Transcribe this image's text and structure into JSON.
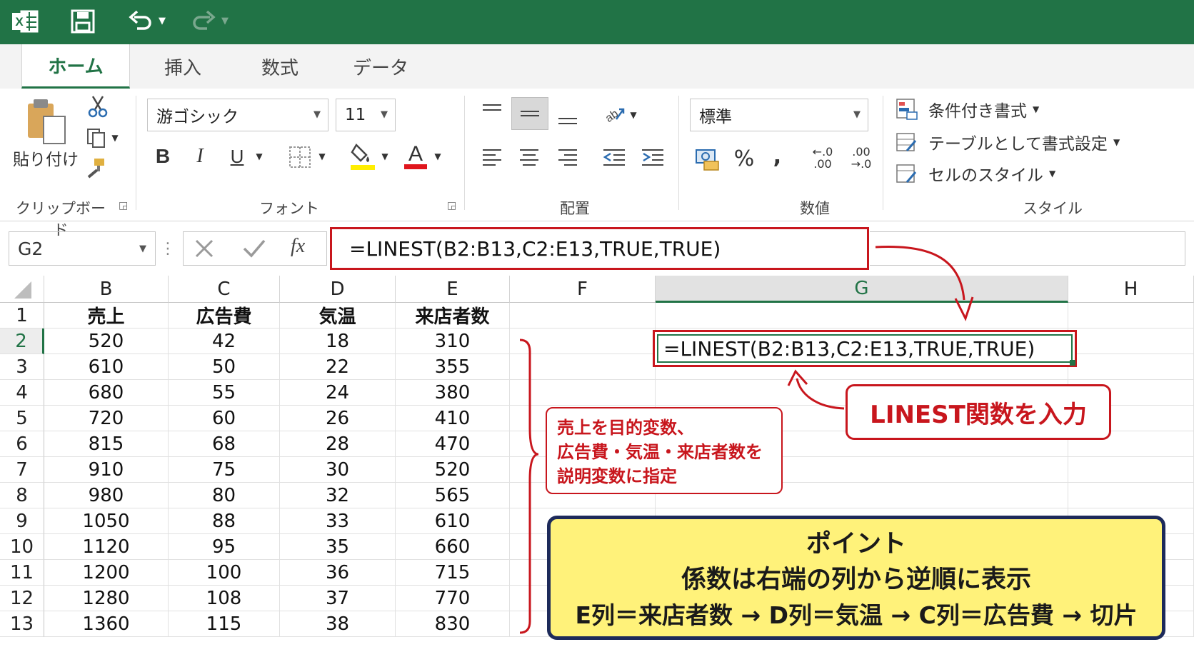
{
  "titlebar": {
    "excel_icon": "excel-logo-icon",
    "save_icon": "save-icon",
    "undo_icon": "undo-icon",
    "redo_icon": "redo-icon"
  },
  "tabs": [
    {
      "label": "ホーム",
      "active": true
    },
    {
      "label": "挿入"
    },
    {
      "label": "数式"
    },
    {
      "label": "データ"
    }
  ],
  "ribbon": {
    "clipboard": {
      "paste_label": "貼り付け",
      "group_label": "クリップボード"
    },
    "font": {
      "font_name": "游ゴシック",
      "font_size": "11",
      "bold": "B",
      "italic": "I",
      "underline": "U",
      "font_color_letter": "A",
      "group_label": "フォント",
      "highlight_color": "#ffee00",
      "font_color": "#e0161d"
    },
    "alignment": {
      "group_label": "配置"
    },
    "number": {
      "format": "標準",
      "percent": "%",
      "comma": "‚",
      "inc_decimal": "←.0\n.00",
      "dec_decimal": ".00\n→.0",
      "group_label": "数値"
    },
    "styles": {
      "conditional": "条件付き書式",
      "table": "テーブルとして書式設定",
      "cell": "セルのスタイル",
      "group_label": "スタイル"
    }
  },
  "formula_bar": {
    "name_box": "G2",
    "fx": "fx",
    "formula": "=LINEST(B2:B13,C2:E13,TRUE,TRUE)"
  },
  "sheet": {
    "columns": [
      "B",
      "C",
      "D",
      "E",
      "F",
      "G",
      "H"
    ],
    "selected_column": "G",
    "rows": [
      "1",
      "2",
      "3",
      "4",
      "5",
      "6",
      "7",
      "8",
      "9",
      "10",
      "11",
      "12",
      "13"
    ],
    "selected_row": "2",
    "header_cells": [
      "売上",
      "広告費",
      "気温",
      "来店者数"
    ],
    "data": [
      [
        "520",
        "42",
        "18",
        "310"
      ],
      [
        "610",
        "50",
        "22",
        "355"
      ],
      [
        "680",
        "55",
        "24",
        "380"
      ],
      [
        "720",
        "60",
        "26",
        "410"
      ],
      [
        "815",
        "68",
        "28",
        "470"
      ],
      [
        "910",
        "75",
        "30",
        "520"
      ],
      [
        "980",
        "80",
        "32",
        "565"
      ],
      [
        "1050",
        "88",
        "33",
        "610"
      ],
      [
        "1120",
        "95",
        "35",
        "660"
      ],
      [
        "1200",
        "100",
        "36",
        "715"
      ],
      [
        "1280",
        "108",
        "37",
        "770"
      ],
      [
        "1360",
        "115",
        "38",
        "830"
      ]
    ],
    "active_cell_value": "=LINEST(B2:B13,C2:E13,TRUE,TRUE)"
  },
  "annotations": {
    "callout_input": "LINEST関数を入力",
    "callout_vars": [
      "売上を目的変数、",
      "広告費・気温・来店者数を",
      "説明変数に指定"
    ],
    "point_title": "ポイント",
    "point_line1": "係数は右端の列から逆順に表示",
    "point_line2": "E列＝来店者数 → D列＝気温 → C列＝広告費 → 切片",
    "accent_red": "#c8161d",
    "excel_green": "#217346",
    "point_bg": "#fff27a"
  }
}
